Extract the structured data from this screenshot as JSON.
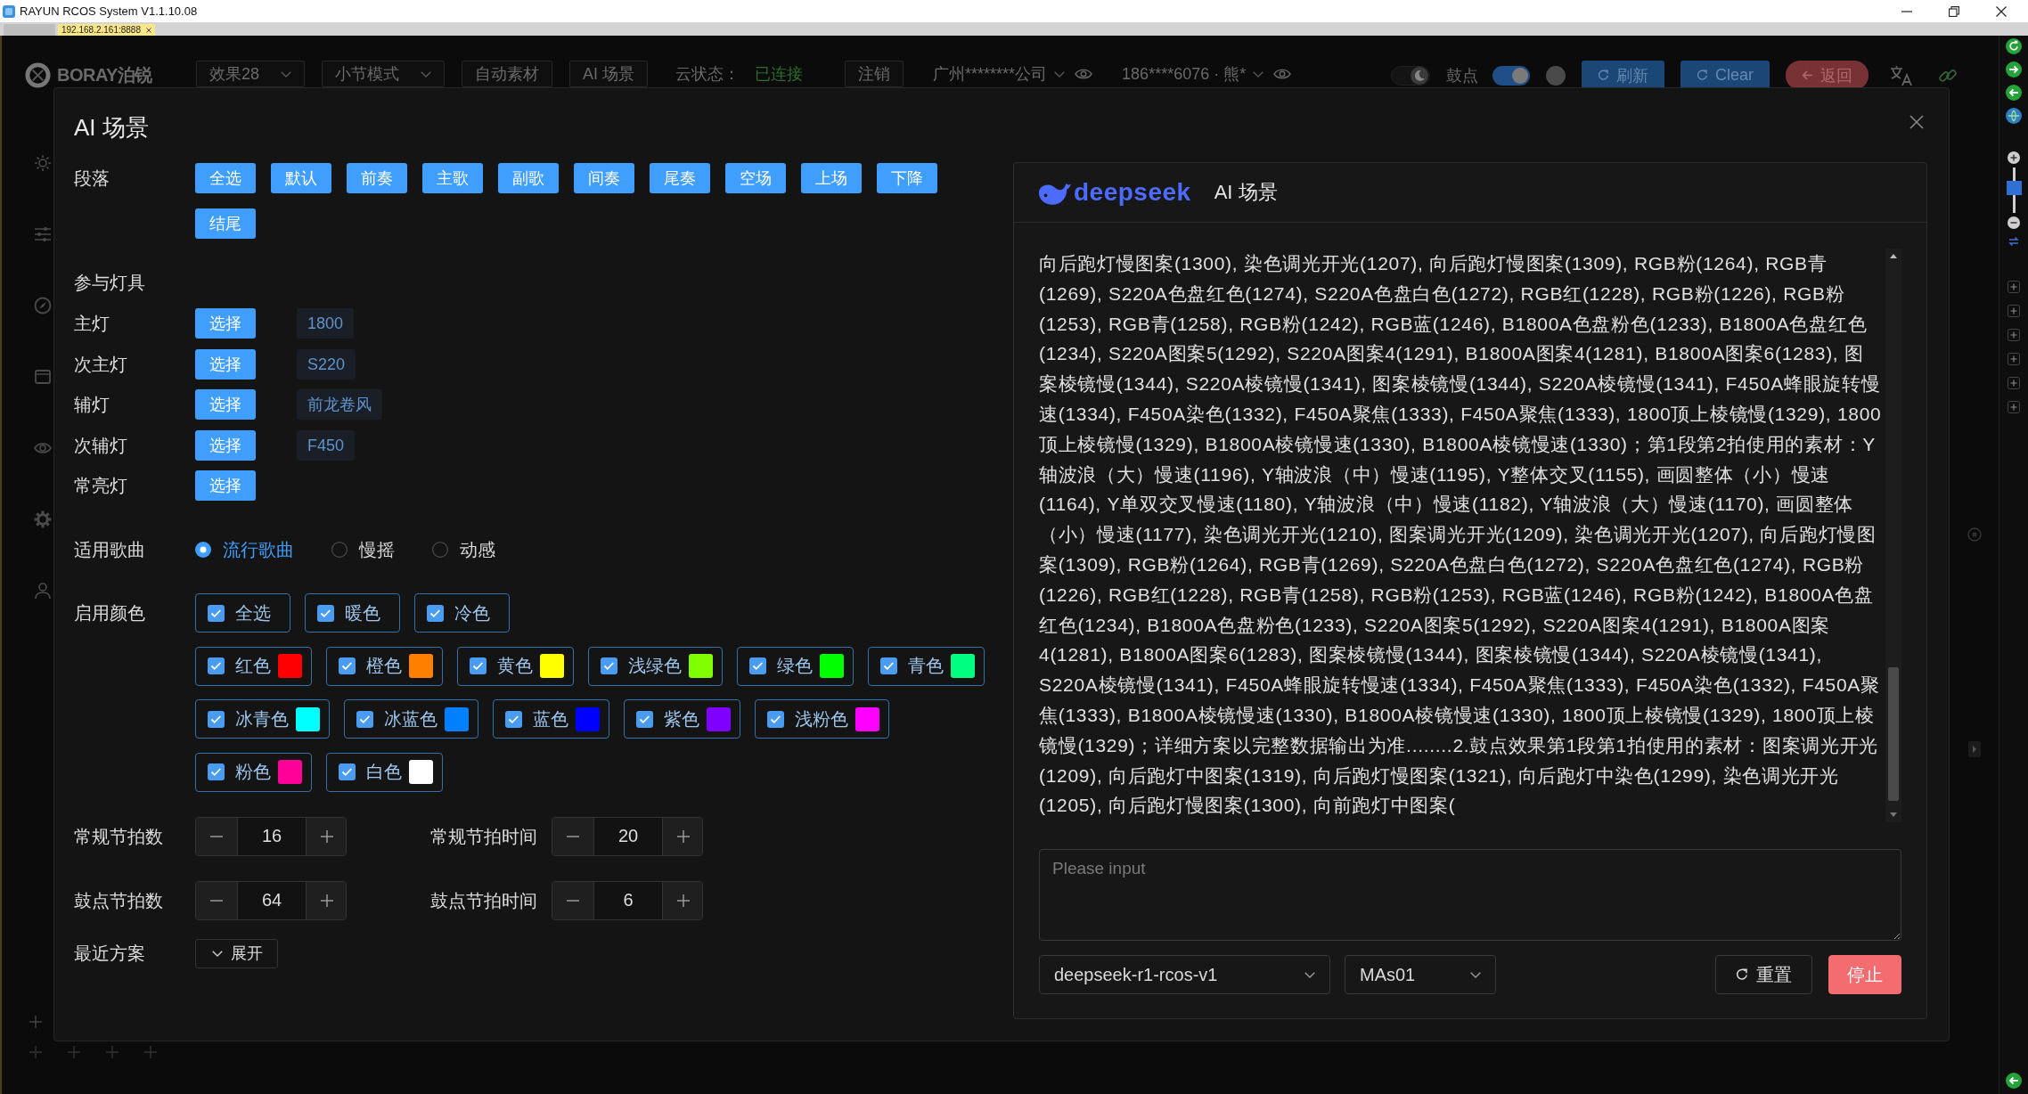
{
  "window": {
    "title": "RAYUN RCOS System V1.1.10.08"
  },
  "browser_tabs": [
    {
      "selected": false
    },
    {
      "label": "192.168.2.161:8888",
      "selected": true
    }
  ],
  "toolbar": {
    "logo": "BORAY泊锐",
    "items": [
      {
        "kind": "dropdown",
        "label": "效果28"
      },
      {
        "kind": "dropdown",
        "label": "小节模式"
      },
      {
        "kind": "button",
        "label": "自动素材"
      },
      {
        "kind": "button",
        "label": "AI 场景"
      },
      {
        "kind": "status",
        "label": "云状态：",
        "value": "已连接"
      },
      {
        "kind": "button",
        "label": "注销"
      },
      {
        "kind": "account",
        "label": "广州********公司"
      },
      {
        "kind": "account",
        "label": "186****6076 · 熊*"
      }
    ],
    "theme_switch": {
      "on": true
    },
    "drum": {
      "label": "鼓点",
      "on": true
    },
    "buttons": [
      {
        "label": "刷新",
        "kind": "primary"
      },
      {
        "label": "Clear",
        "kind": "primary"
      },
      {
        "label": "返回",
        "kind": "danger"
      }
    ]
  },
  "zoom_slider": {
    "level": 0.55
  },
  "dialog": {
    "title": "AI 场景",
    "sections": {
      "label": "段落",
      "buttons": [
        "全选",
        "默认",
        "前奏",
        "主歌",
        "副歌",
        "间奏",
        "尾奏",
        "空场",
        "上场",
        "下降",
        "结尾"
      ]
    },
    "fixtures": {
      "heading": "参与灯具",
      "rows": [
        {
          "label": "主灯",
          "button": "选择",
          "value": "1800"
        },
        {
          "label": "次主灯",
          "button": "选择",
          "value": "S220"
        },
        {
          "label": "辅灯",
          "button": "选择",
          "value": "前龙卷风"
        },
        {
          "label": "次辅灯",
          "button": "选择",
          "value": "F450"
        },
        {
          "label": "常亮灯",
          "button": "选择"
        }
      ]
    },
    "song_type": {
      "label": "适用歌曲",
      "options": [
        {
          "label": "流行歌曲",
          "selected": true
        },
        {
          "label": "慢摇",
          "selected": false
        },
        {
          "label": "动感",
          "selected": false
        }
      ]
    },
    "colors": {
      "label": "启用颜色",
      "groups": [
        {
          "label": "全选",
          "checked": true
        },
        {
          "label": "暖色",
          "checked": true
        },
        {
          "label": "冷色",
          "checked": true
        }
      ],
      "items": [
        {
          "label": "红色",
          "checked": true,
          "color": "#ff0000"
        },
        {
          "label": "橙色",
          "checked": true,
          "color": "#ff8000"
        },
        {
          "label": "黄色",
          "checked": true,
          "color": "#ffff00"
        },
        {
          "label": "浅绿色",
          "checked": true,
          "color": "#80ff00"
        },
        {
          "label": "绿色",
          "checked": true,
          "color": "#00ff00"
        },
        {
          "label": "青色",
          "checked": true,
          "color": "#00ff80"
        },
        {
          "label": "冰青色",
          "checked": true,
          "color": "#00ffff"
        },
        {
          "label": "冰蓝色",
          "checked": true,
          "color": "#0080ff"
        },
        {
          "label": "蓝色",
          "checked": true,
          "color": "#0000ff"
        },
        {
          "label": "紫色",
          "checked": true,
          "color": "#8000ff"
        },
        {
          "label": "浅粉色",
          "checked": true,
          "color": "#ff00ff"
        },
        {
          "label": "粉色",
          "checked": true,
          "color": "#ff0099"
        },
        {
          "label": "白色",
          "checked": true,
          "color": "#ffffff"
        }
      ]
    },
    "steppers": [
      {
        "label": "常规节拍数",
        "value": "16"
      },
      {
        "label": "常规节拍时间",
        "value": "20"
      },
      {
        "label": "鼓点节拍数",
        "value": "64"
      },
      {
        "label": "鼓点节拍时间",
        "value": "6"
      }
    ],
    "recent": {
      "label": "最近方案",
      "button": "展开",
      "expanded": false
    },
    "chat": {
      "brand": "deepseek",
      "title": "AI 场景",
      "output": "向后跑灯慢图案(1300), 染色调光开光(1207), 向后跑灯慢图案(1309), RGB粉(1264), RGB青(1269), S220A色盘红色(1274), S220A色盘白色(1272), RGB红(1228), RGB粉(1226), RGB粉(1253), RGB青(1258), RGB粉(1242), RGB蓝(1246), B1800A色盘粉色(1233), B1800A色盘红色(1234), S220A图案5(1292), S220A图案4(1291), B1800A图案4(1281), B1800A图案6(1283), 图案棱镜慢(1344), S220A棱镜慢(1341), 图案棱镜慢(1344), S220A棱镜慢(1341), F450A蜂眼旋转慢速(1334), F450A染色(1332), F450A聚焦(1333), F450A聚焦(1333), 1800顶上棱镜慢(1329), 1800顶上棱镜慢(1329), B1800A棱镜慢速(1330), B1800A棱镜慢速(1330)；第1段第2拍使用的素材：Y轴波浪（大）慢速(1196), Y轴波浪（中）慢速(1195), Y整体交叉(1155), 画圆整体（小）慢速(1164), Y单双交叉慢速(1180), Y轴波浪（中）慢速(1182), Y轴波浪（大）慢速(1170), 画圆整体（小）慢速(1177), 染色调光开光(1210), 图案调光开光(1209), 染色调光开光(1207), 向后跑灯慢图案(1309), RGB粉(1264), RGB青(1269), S220A色盘白色(1272), S220A色盘红色(1274), RGB粉(1226), RGB红(1228), RGB青(1258), RGB粉(1253), RGB蓝(1246), RGB粉(1242), B1800A色盘红色(1234), B1800A色盘粉色(1233), S220A图案5(1292), S220A图案4(1291), B1800A图案4(1281), B1800A图案6(1283), 图案棱镜慢(1344), 图案棱镜慢(1344), S220A棱镜慢(1341), S220A棱镜慢(1341), F450A蜂眼旋转慢速(1334), F450A聚焦(1333), F450A染色(1332), F450A聚焦(1333), B1800A棱镜慢速(1330), B1800A棱镜慢速(1330), 1800顶上棱镜慢(1329), 1800顶上棱镜慢(1329)；详细方案以完整数据输出为准........2.鼓点效果第1段第1拍使用的素材：图案调光开光(1209), 向后跑灯中图案(1319), 向后跑灯慢图案(1321), 向后跑灯中染色(1299), 染色调光开光(1205), 向后跑灯慢图案(1300), 向前跑灯中图案(",
      "input": {
        "placeholder": "Please input"
      },
      "model": "deepseek-r1-rcos-v1",
      "agent": "MAs01",
      "buttons": [
        {
          "label": "重置",
          "kind": "default"
        },
        {
          "label": "停止",
          "kind": "danger"
        }
      ]
    }
  }
}
